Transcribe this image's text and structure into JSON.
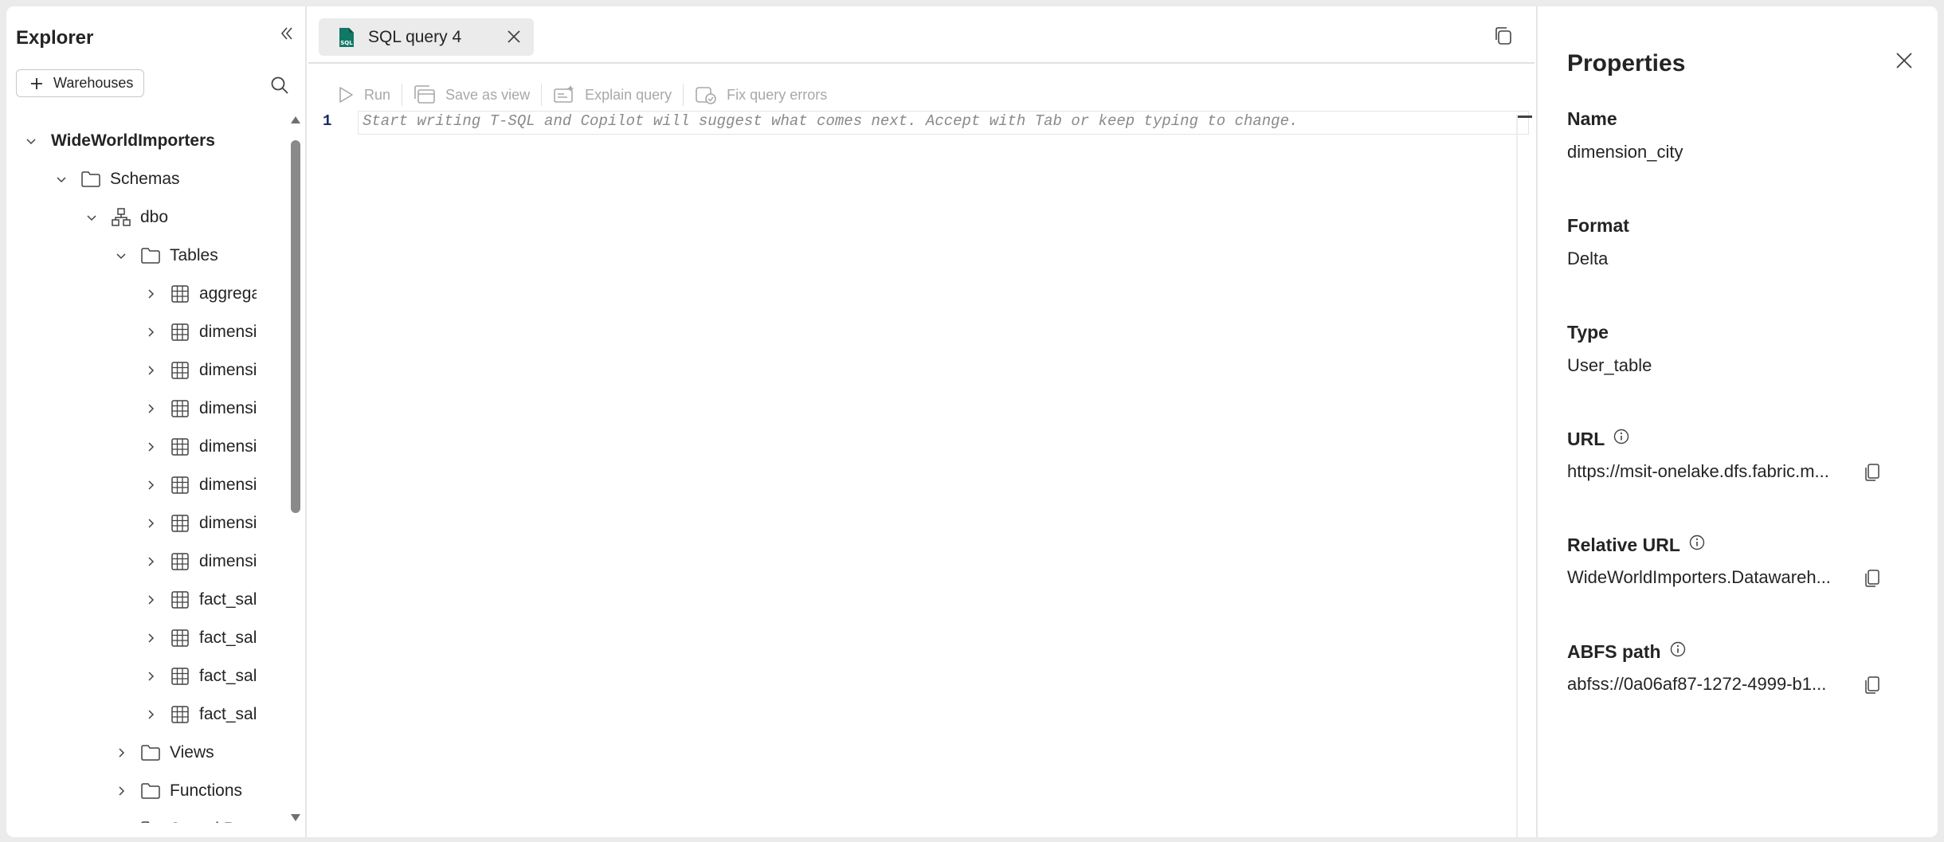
{
  "explorer": {
    "title": "Explorer",
    "warehouses_button": "Warehouses",
    "tree": [
      {
        "label": "WideWorldImporters",
        "level": 0,
        "expanded": true,
        "icon": "none",
        "bold": true
      },
      {
        "label": "Schemas",
        "level": 1,
        "expanded": true,
        "icon": "folder-icon"
      },
      {
        "label": "dbo",
        "level": 2,
        "expanded": true,
        "icon": "schema-icon"
      },
      {
        "label": "Tables",
        "level": 3,
        "expanded": true,
        "icon": "folder-icon"
      },
      {
        "label": "aggrega",
        "level": 4,
        "expanded": false,
        "icon": "table-icon"
      },
      {
        "label": "dimensi",
        "level": 4,
        "expanded": false,
        "icon": "table-icon"
      },
      {
        "label": "dimensi",
        "level": 4,
        "expanded": false,
        "icon": "table-icon"
      },
      {
        "label": "dimensi",
        "level": 4,
        "expanded": false,
        "icon": "table-icon"
      },
      {
        "label": "dimensi",
        "level": 4,
        "expanded": false,
        "icon": "table-icon"
      },
      {
        "label": "dimensi",
        "level": 4,
        "expanded": false,
        "icon": "table-icon"
      },
      {
        "label": "dimensi",
        "level": 4,
        "expanded": false,
        "icon": "table-icon"
      },
      {
        "label": "dimensi",
        "level": 4,
        "expanded": false,
        "icon": "table-icon"
      },
      {
        "label": "fact_sale",
        "level": 4,
        "expanded": false,
        "icon": "table-icon"
      },
      {
        "label": "fact_sale",
        "level": 4,
        "expanded": false,
        "icon": "table-icon"
      },
      {
        "label": "fact_sale",
        "level": 4,
        "expanded": false,
        "icon": "table-icon"
      },
      {
        "label": "fact_sale",
        "level": 4,
        "expanded": false,
        "icon": "table-icon"
      },
      {
        "label": "Views",
        "level": 3,
        "expanded": false,
        "icon": "folder-icon"
      },
      {
        "label": "Functions",
        "level": 3,
        "expanded": false,
        "icon": "folder-icon"
      },
      {
        "label": "Stored Pr",
        "level": 3,
        "expanded": false,
        "icon": "folder-icon"
      }
    ]
  },
  "editor": {
    "tab_label": "SQL query 4",
    "tab_icon": "sql-file-icon",
    "toolbar": {
      "run": "Run",
      "save_as_view": "Save as view",
      "explain_query": "Explain query",
      "fix_query_errors": "Fix query errors"
    },
    "line_number": "1",
    "placeholder": "Start writing T-SQL and Copilot will suggest what comes next. Accept with Tab or keep typing to change."
  },
  "properties": {
    "title": "Properties",
    "fields": [
      {
        "label": "Name",
        "value": "dimension_city",
        "info": false,
        "copy": false
      },
      {
        "label": "Format",
        "value": "Delta",
        "info": false,
        "copy": false
      },
      {
        "label": "Type",
        "value": "User_table",
        "info": false,
        "copy": false
      },
      {
        "label": "URL",
        "value": "https://msit-onelake.dfs.fabric.m...",
        "info": true,
        "copy": true
      },
      {
        "label": "Relative URL",
        "value": "WideWorldImporters.Datawareh...",
        "info": true,
        "copy": true
      },
      {
        "label": "ABFS path",
        "value": "abfss://0a06af87-1272-4999-b1...",
        "info": true,
        "copy": true
      }
    ]
  },
  "colors": {
    "accent_sql_icon": "#117865",
    "disabled_text": "#a8a8a8",
    "line_number": "#1b2b64"
  }
}
